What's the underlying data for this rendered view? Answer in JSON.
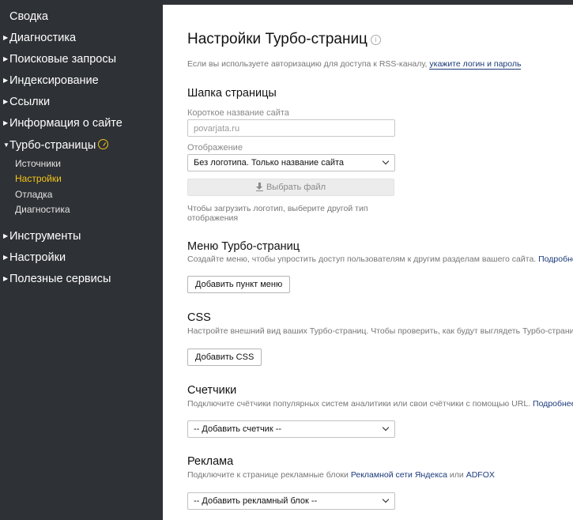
{
  "sidebar": {
    "summary": "Сводка",
    "items": [
      "Диагностика",
      "Поисковые запросы",
      "Индексирование",
      "Ссылки",
      "Информация о сайте",
      "Турбо-страницы",
      "Инструменты",
      "Настройки",
      "Полезные сервисы"
    ],
    "turbo_sub": [
      "Источники",
      "Настройки",
      "Отладка",
      "Диагностика"
    ],
    "active_sub_index": 1
  },
  "page": {
    "title": "Настройки Турбо-страниц",
    "info_icon": "i",
    "rss_hint": "Если вы используете авторизацию для доступа к RSS-каналу,",
    "rss_link": "укажите логин и пароль"
  },
  "header_section": {
    "title": "Шапка страницы",
    "short_name_label": "Короткое название сайта",
    "short_name_value": "povarjata.ru",
    "display_label": "Отображение",
    "display_value": "Без логотипа. Только название сайта",
    "file_button": "Выбрать файл",
    "logo_hint_1": "Чтобы загрузить логотип, выберите другой тип",
    "logo_hint_2": "отображения"
  },
  "menu_section": {
    "title": "Меню Турбо-страниц",
    "hint": "Создайте меню, чтобы упростить доступ пользователям к другим разделам вашего сайта.",
    "more": "Подробнее",
    "button": "Добавить пункт меню"
  },
  "css_section": {
    "title": "CSS",
    "hint": "Настройте внешний вид ваших Турбо-страниц. Чтобы проверить, как будут выглядеть Турбо-страницы,",
    "button": "Добавить CSS"
  },
  "counters_section": {
    "title": "Счетчики",
    "hint": "Подключите счётчики популярных систем аналитики или свои счётчики с помощью URL.",
    "more": "Подробнее",
    "select": "-- Добавить счетчик --"
  },
  "ads_section": {
    "title": "Реклама",
    "hint": "Подключите к странице рекламные блоки",
    "link1": "Рекламной сети Яндекса",
    "or": "или",
    "link2": "ADFOX",
    "select": "-- Добавить рекламный блок --"
  },
  "colors": {
    "sidebar_bg": "#2e3135",
    "active": "#f5c51c",
    "link": "#1a3a7a"
  }
}
